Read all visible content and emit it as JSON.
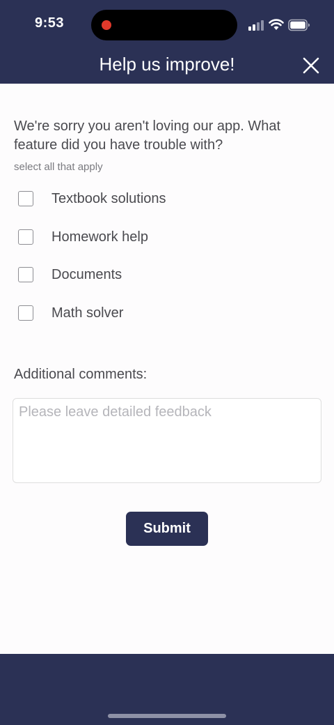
{
  "status_bar": {
    "time": "9:53"
  },
  "header": {
    "title": "Help us improve!",
    "close_icon": "close-icon"
  },
  "survey": {
    "question": "We're sorry you aren't loving our app. What feature did you have trouble with?",
    "hint": "select all that apply",
    "options": [
      {
        "label": "Textbook solutions",
        "checked": false
      },
      {
        "label": "Homework help",
        "checked": false
      },
      {
        "label": "Documents",
        "checked": false
      },
      {
        "label": "Math solver",
        "checked": false
      }
    ],
    "comments_label": "Additional comments:",
    "comments_value": "",
    "comments_placeholder": "Please leave detailed feedback",
    "submit_label": "Submit"
  },
  "colors": {
    "brand": "#2b3155",
    "background": "#fdfcfd",
    "text": "#4a4a4f",
    "recording": "#e0392b"
  }
}
